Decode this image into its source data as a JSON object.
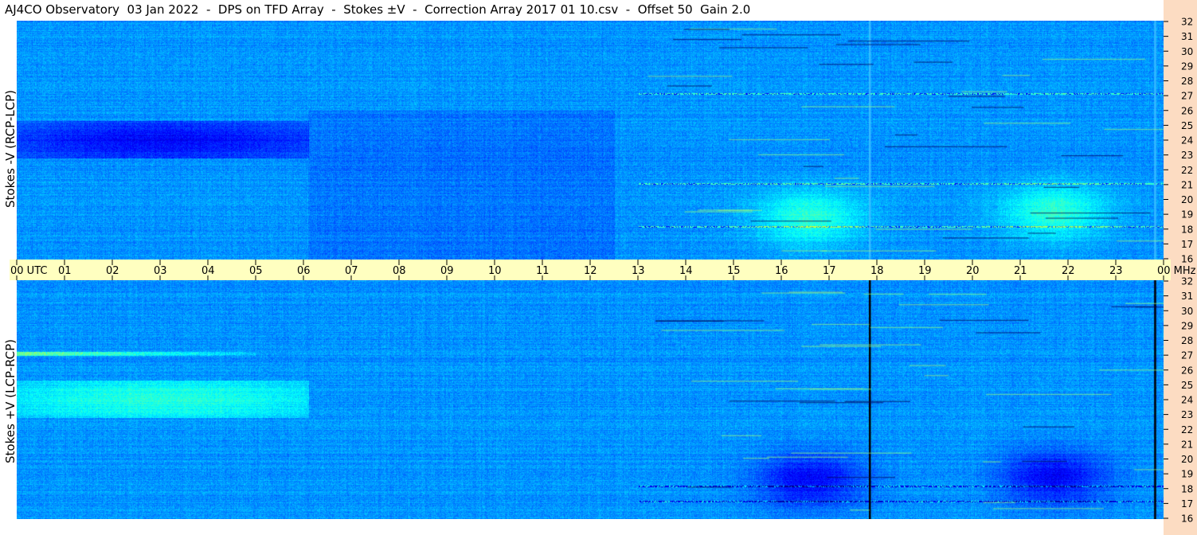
{
  "title": "AJ4CO Observatory  03 Jan 2022  -  DPS on TFD Array  -  Stokes ±V  -  Correction Array 2017 01 10.csv  -  Offset 50  Gain 2.0",
  "chart_data": [
    {
      "type": "heatmap",
      "panel": "top",
      "ylabel": "Stokes -V  (RCP-LCP)",
      "x_ticks": [
        "00 UTC",
        "01",
        "02",
        "03",
        "04",
        "05",
        "06",
        "07",
        "08",
        "09",
        "10",
        "11",
        "12",
        "13",
        "14",
        "15",
        "16",
        "17",
        "18",
        "19",
        "20",
        "21",
        "22",
        "23",
        "00 MHz"
      ],
      "xlim": [
        0,
        24
      ],
      "x_unit": "UTC",
      "y_ticks": [
        "32",
        "31",
        "30",
        "29",
        "28",
        "27",
        "26",
        "25",
        "24",
        "23",
        "22",
        "21",
        "20",
        "19",
        "18",
        "17",
        "16"
      ],
      "ylim": [
        16,
        32
      ],
      "y_unit": "MHz",
      "colormap": [
        "#00008f",
        "#0000ff",
        "#0080ff",
        "#00ffff",
        "#80ff80",
        "#ffff00",
        "#ff8000"
      ],
      "features": [
        {
          "kind": "dark_band",
          "time_range": [
            0,
            6.1
          ],
          "freq_range": [
            22.8,
            25.3
          ]
        },
        {
          "kind": "dark_region",
          "time_range": [
            6.1,
            12.5
          ],
          "freq_range": [
            16,
            26.0
          ]
        },
        {
          "kind": "bright_blob",
          "time_center": 16.6,
          "freq_center": 18.8
        },
        {
          "kind": "bright_blob",
          "time_center": 21.7,
          "freq_center": 19.2
        },
        {
          "kind": "interference_line",
          "freq": 27.1
        },
        {
          "kind": "interference_line",
          "freq": 21.1
        },
        {
          "kind": "interference_line",
          "freq": 18.2
        },
        {
          "kind": "vertical_line",
          "time": 17.85
        },
        {
          "kind": "vertical_line",
          "time": 23.82
        }
      ]
    },
    {
      "type": "heatmap",
      "panel": "bottom",
      "ylabel": "Stokes +V  (LCP-RCP)",
      "x_ticks": [
        "00 UTC",
        "01",
        "02",
        "03",
        "04",
        "05",
        "06",
        "07",
        "08",
        "09",
        "10",
        "11",
        "12",
        "13",
        "14",
        "15",
        "16",
        "17",
        "18",
        "19",
        "20",
        "21",
        "22",
        "23",
        "00 MHz"
      ],
      "xlim": [
        0,
        24
      ],
      "x_unit": "UTC",
      "y_ticks": [
        "32",
        "31",
        "30",
        "29",
        "28",
        "27",
        "26",
        "25",
        "24",
        "23",
        "22",
        "21",
        "20",
        "19",
        "18",
        "17",
        "16"
      ],
      "ylim": [
        16,
        32
      ],
      "y_unit": "MHz",
      "colormap": [
        "#00008f",
        "#0000ff",
        "#0080ff",
        "#00ffff",
        "#80ff80",
        "#ffff00",
        "#ff8000"
      ],
      "features": [
        {
          "kind": "bright_band",
          "time_range": [
            0,
            6.1
          ],
          "freq_range": [
            22.8,
            25.3
          ]
        },
        {
          "kind": "bright_streak",
          "time_range": [
            0,
            5.0
          ],
          "freq": 27.1
        },
        {
          "kind": "dark_blob",
          "time_center": 16.6,
          "freq_center": 18.6
        },
        {
          "kind": "dark_blob",
          "time_center": 21.7,
          "freq_center": 18.8
        },
        {
          "kind": "interference_line",
          "freq": 18.2
        },
        {
          "kind": "interference_line",
          "freq": 17.2
        },
        {
          "kind": "black_vertical_line",
          "time": 17.85
        },
        {
          "kind": "black_vertical_line",
          "time": 23.82
        }
      ]
    }
  ]
}
